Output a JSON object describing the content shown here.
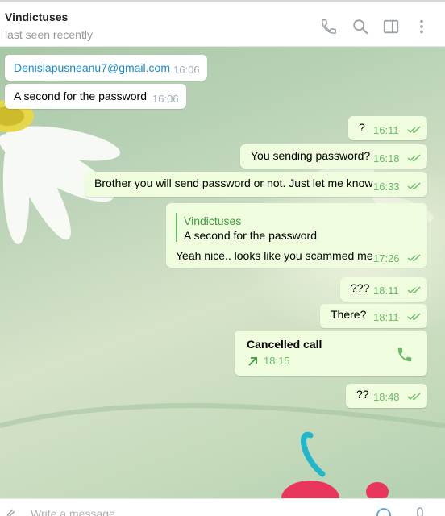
{
  "header": {
    "contact_name": "Vindictuses",
    "status": "last seen recently",
    "icons": [
      "phone-icon",
      "search-icon",
      "sidebar-toggle-icon",
      "more-vertical-icon"
    ]
  },
  "messages": [
    {
      "direction": "in",
      "text": "Denislapusneanu7@gmail.com",
      "time": "16:06",
      "is_link": true
    },
    {
      "direction": "in",
      "text": "A second for the password",
      "time": "16:06"
    },
    {
      "direction": "out",
      "text": "?",
      "time": "16:11",
      "read": true
    },
    {
      "direction": "out",
      "text": "You sending password?",
      "time": "16:18",
      "read": true
    },
    {
      "direction": "out",
      "text": "Brother you will send password or not. Just let me know",
      "time": "16:33",
      "read": true
    },
    {
      "direction": "out",
      "reply_to_name": "Vindictuses",
      "reply_to_text": "A second for the password",
      "text": "Yeah nice.. looks like you scammed me",
      "time": "17:26",
      "read": true
    },
    {
      "direction": "out",
      "text": "???",
      "time": "18:11",
      "read": true
    },
    {
      "direction": "out",
      "text": "There?",
      "time": "18:11",
      "read": true
    },
    {
      "direction": "out",
      "call_title": "Cancelled call",
      "time": "18:15",
      "icon": "phone-icon"
    },
    {
      "direction": "out",
      "text": "??",
      "time": "18:48",
      "read": true
    }
  ],
  "composer": {
    "placeholder": "Write a message..."
  },
  "colors": {
    "outgoing_bubble": "#effdde",
    "incoming_bubble": "#ffffff",
    "accent_green": "#6cbb6b",
    "link_blue": "#168acd"
  }
}
